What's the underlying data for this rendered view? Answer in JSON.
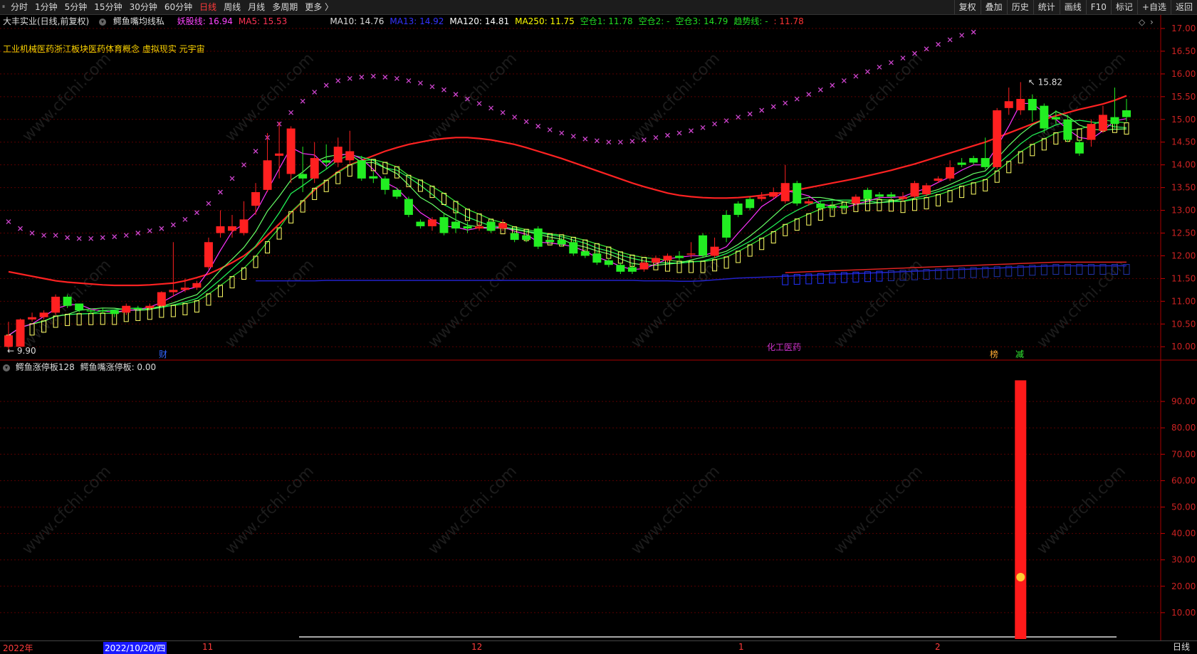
{
  "toolbar": {
    "left_items": [
      "分时",
      "1分钟",
      "5分钟",
      "15分钟",
      "30分钟",
      "60分钟",
      "日线",
      "周线",
      "月线",
      "多周期",
      "更多 〉"
    ],
    "active": "日线",
    "right_items": [
      "复权",
      "叠加",
      "历史",
      "统计",
      "画线",
      "F10",
      "标记",
      "+自选",
      "返回"
    ]
  },
  "header": {
    "stock": "大丰实业(日线,前复权)",
    "indicator": "鳄鱼嘴均线私",
    "values": [
      {
        "label": "妖股线: 16.94",
        "color": "#ff44ff"
      },
      {
        "label": "MA5: 15.53",
        "color": "#ff3355"
      },
      {
        "label": "MA10: 14.76",
        "color": "#dddddd"
      },
      {
        "label": "MA13: 14.92",
        "color": "#3333ff"
      },
      {
        "label": "MA120: 14.81",
        "color": "#ffffff"
      },
      {
        "label": "MA250: 11.75",
        "color": "#ffff00"
      },
      {
        "label": "空仓1: 11.78",
        "color": "#22dd22"
      },
      {
        "label": "空仓2: -",
        "color": "#22dd22"
      },
      {
        "label": "空仓3: 14.79",
        "color": "#22dd22"
      },
      {
        "label": "趋势线: -",
        "color": "#22dd22"
      },
      {
        "label": ": 11.78",
        "color": "#ff3333"
      }
    ]
  },
  "concepts": "工业机械医药浙江板块医药体育概念 虚拟现实 元宇宙",
  "annotations": {
    "low_label": "9.90",
    "high_label": "15.82",
    "marker_cai": "财",
    "marker_chem": "化工医药",
    "marker_bang": "榜",
    "marker_jian": "减"
  },
  "price_axis": [
    "17.00",
    "16.50",
    "16.00",
    "15.50",
    "15.00",
    "14.50",
    "14.00",
    "13.50",
    "13.00",
    "12.50",
    "12.00",
    "11.50",
    "11.00",
    "10.50",
    "10.00"
  ],
  "lower_panel": {
    "title": "鳄鱼涨停板128",
    "value": "鳄鱼嘴涨停板: 0.00",
    "axis": [
      "90.00",
      "80.00",
      "70.00",
      "60.00",
      "50.00",
      "40.00",
      "30.00",
      "20.00",
      "10.00"
    ],
    "bar_value": 98
  },
  "timeline": {
    "year": "2022年",
    "date_box": "2022/10/20/四",
    "months": [
      "11",
      "12",
      "1",
      "2"
    ]
  },
  "period_label": "日线",
  "watermark": "www.cfchi.com",
  "colors": {
    "up": "#ff2020",
    "down": "#22ee22",
    "ma_red": "#ff2222",
    "magenta": "#ff33ff",
    "cross": "#cc44cc",
    "blue": "#2222cc",
    "yellow": "#ffff66"
  },
  "chart_data": {
    "type": "candlestick",
    "price_range": [
      9.8,
      17.0
    ],
    "candles": [
      {
        "o": 10.0,
        "c": 10.25,
        "h": 10.55,
        "l": 9.9
      },
      {
        "o": 10.0,
        "c": 10.6,
        "h": 10.62,
        "l": 10.0
      },
      {
        "o": 10.6,
        "c": 10.65,
        "h": 10.75,
        "l": 10.55
      },
      {
        "o": 10.65,
        "c": 10.75,
        "h": 10.8,
        "l": 10.6
      },
      {
        "o": 10.75,
        "c": 11.1,
        "h": 11.15,
        "l": 10.7
      },
      {
        "o": 11.1,
        "c": 10.9,
        "h": 11.15,
        "l": 10.85
      },
      {
        "o": 10.95,
        "c": 10.8,
        "h": 10.95,
        "l": 10.75
      },
      {
        "o": 10.8,
        "c": 10.78,
        "h": 10.85,
        "l": 10.72
      },
      {
        "o": 10.8,
        "c": 10.78,
        "h": 10.85,
        "l": 10.72
      },
      {
        "o": 10.8,
        "c": 10.72,
        "h": 10.82,
        "l": 10.65
      },
      {
        "o": 10.75,
        "c": 10.9,
        "h": 10.95,
        "l": 10.7
      },
      {
        "o": 10.85,
        "c": 10.82,
        "h": 10.9,
        "l": 10.78
      },
      {
        "o": 10.85,
        "c": 10.9,
        "h": 10.95,
        "l": 10.8
      },
      {
        "o": 10.9,
        "c": 11.2,
        "h": 11.22,
        "l": 10.88
      },
      {
        "o": 11.2,
        "c": 11.25,
        "h": 12.3,
        "l": 11.1
      },
      {
        "o": 11.25,
        "c": 11.3,
        "h": 11.5,
        "l": 11.2
      },
      {
        "o": 11.3,
        "c": 11.4,
        "h": 11.45,
        "l": 11.25
      },
      {
        "o": 11.75,
        "c": 12.3,
        "h": 12.4,
        "l": 11.7
      },
      {
        "o": 12.5,
        "c": 12.65,
        "h": 13.0,
        "l": 12.4
      },
      {
        "o": 12.55,
        "c": 12.65,
        "h": 12.9,
        "l": 12.4
      },
      {
        "o": 12.5,
        "c": 12.8,
        "h": 13.2,
        "l": 12.45
      },
      {
        "o": 13.1,
        "c": 13.4,
        "h": 13.6,
        "l": 12.9
      },
      {
        "o": 13.45,
        "c": 14.1,
        "h": 14.7,
        "l": 13.4
      },
      {
        "o": 14.2,
        "c": 14.25,
        "h": 14.95,
        "l": 13.7
      },
      {
        "o": 13.8,
        "c": 14.8,
        "h": 14.85,
        "l": 13.6
      },
      {
        "o": 13.8,
        "c": 13.7,
        "h": 14.4,
        "l": 13.4
      },
      {
        "o": 13.7,
        "c": 14.15,
        "h": 14.5,
        "l": 13.6
      },
      {
        "o": 14.1,
        "c": 14.05,
        "h": 14.45,
        "l": 13.9
      },
      {
        "o": 14.05,
        "c": 14.4,
        "h": 14.6,
        "l": 13.95
      },
      {
        "o": 14.1,
        "c": 14.3,
        "h": 14.75,
        "l": 14.0
      },
      {
        "o": 14.1,
        "c": 13.7,
        "h": 14.2,
        "l": 13.65
      },
      {
        "o": 13.75,
        "c": 13.7,
        "h": 13.85,
        "l": 13.6
      },
      {
        "o": 13.7,
        "c": 13.45,
        "h": 13.75,
        "l": 13.35
      },
      {
        "o": 13.45,
        "c": 13.3,
        "h": 13.5,
        "l": 13.25
      },
      {
        "o": 13.25,
        "c": 12.9,
        "h": 13.3,
        "l": 12.85
      },
      {
        "o": 12.75,
        "c": 12.65,
        "h": 12.8,
        "l": 12.6
      },
      {
        "o": 12.65,
        "c": 12.8,
        "h": 12.85,
        "l": 12.55
      },
      {
        "o": 12.85,
        "c": 12.5,
        "h": 12.95,
        "l": 12.45
      },
      {
        "o": 12.75,
        "c": 12.6,
        "h": 13.05,
        "l": 12.5
      },
      {
        "o": 12.65,
        "c": 12.6,
        "h": 12.75,
        "l": 12.5
      },
      {
        "o": 12.6,
        "c": 12.65,
        "h": 12.75,
        "l": 12.55
      },
      {
        "o": 12.75,
        "c": 12.55,
        "h": 12.8,
        "l": 12.5
      },
      {
        "o": 12.6,
        "c": 12.72,
        "h": 12.8,
        "l": 12.55
      },
      {
        "o": 12.5,
        "c": 12.35,
        "h": 12.55,
        "l": 12.3
      },
      {
        "o": 12.45,
        "c": 12.35,
        "h": 12.55,
        "l": 12.3
      },
      {
        "o": 12.6,
        "c": 12.2,
        "h": 12.65,
        "l": 12.15
      },
      {
        "o": 12.35,
        "c": 12.3,
        "h": 12.4,
        "l": 12.25
      },
      {
        "o": 12.35,
        "c": 12.25,
        "h": 12.4,
        "l": 12.2
      },
      {
        "o": 12.3,
        "c": 12.05,
        "h": 12.35,
        "l": 12.0
      },
      {
        "o": 12.1,
        "c": 12.0,
        "h": 12.15,
        "l": 11.95
      },
      {
        "o": 12.05,
        "c": 11.85,
        "h": 12.1,
        "l": 11.8
      },
      {
        "o": 11.9,
        "c": 11.8,
        "h": 11.95,
        "l": 11.75
      },
      {
        "o": 11.8,
        "c": 11.65,
        "h": 11.85,
        "l": 11.6
      },
      {
        "o": 11.75,
        "c": 11.65,
        "h": 11.85,
        "l": 11.6
      },
      {
        "o": 11.7,
        "c": 11.85,
        "h": 11.9,
        "l": 11.65
      },
      {
        "o": 11.85,
        "c": 11.95,
        "h": 12.0,
        "l": 11.8
      },
      {
        "o": 11.9,
        "c": 12.0,
        "h": 12.05,
        "l": 11.85
      },
      {
        "o": 12.0,
        "c": 11.95,
        "h": 12.1,
        "l": 11.9
      },
      {
        "o": 12.05,
        "c": 12.05,
        "h": 12.3,
        "l": 11.95
      },
      {
        "o": 12.45,
        "c": 12.0,
        "h": 12.5,
        "l": 11.95
      },
      {
        "o": 12.0,
        "c": 12.2,
        "h": 12.4,
        "l": 11.95
      },
      {
        "o": 12.9,
        "c": 12.4,
        "h": 13.0,
        "l": 12.3
      },
      {
        "o": 13.15,
        "c": 12.9,
        "h": 13.2,
        "l": 12.85
      },
      {
        "o": 13.25,
        "c": 13.05,
        "h": 13.3,
        "l": 13.0
      },
      {
        "o": 13.25,
        "c": 13.3,
        "h": 13.4,
        "l": 13.2
      },
      {
        "o": 13.3,
        "c": 13.4,
        "h": 13.5,
        "l": 13.25
      },
      {
        "o": 13.2,
        "c": 13.6,
        "h": 14.0,
        "l": 13.15
      },
      {
        "o": 13.6,
        "c": 13.15,
        "h": 13.65,
        "l": 13.1
      },
      {
        "o": 13.15,
        "c": 13.2,
        "h": 13.25,
        "l": 13.1
      },
      {
        "o": 13.15,
        "c": 13.05,
        "h": 13.2,
        "l": 13.0
      },
      {
        "o": 13.1,
        "c": 13.05,
        "h": 13.2,
        "l": 13.0
      },
      {
        "o": 13.1,
        "c": 13.05,
        "h": 13.15,
        "l": 13.0
      },
      {
        "o": 13.15,
        "c": 13.3,
        "h": 13.35,
        "l": 13.1
      },
      {
        "o": 13.45,
        "c": 13.25,
        "h": 13.5,
        "l": 13.2
      },
      {
        "o": 13.35,
        "c": 13.3,
        "h": 13.4,
        "l": 13.25
      },
      {
        "o": 13.35,
        "c": 13.3,
        "h": 13.4,
        "l": 13.25
      },
      {
        "o": 13.25,
        "c": 13.3,
        "h": 13.4,
        "l": 13.2
      },
      {
        "o": 13.3,
        "c": 13.6,
        "h": 13.65,
        "l": 13.25
      },
      {
        "o": 13.35,
        "c": 13.55,
        "h": 13.6,
        "l": 13.3
      },
      {
        "o": 13.65,
        "c": 13.7,
        "h": 13.75,
        "l": 13.6
      },
      {
        "o": 13.7,
        "c": 13.95,
        "h": 14.1,
        "l": 13.65
      },
      {
        "o": 14.05,
        "c": 14.0,
        "h": 14.15,
        "l": 13.95
      },
      {
        "o": 14.15,
        "c": 14.05,
        "h": 14.2,
        "l": 14.0
      },
      {
        "o": 14.15,
        "c": 13.95,
        "h": 14.6,
        "l": 13.9
      },
      {
        "o": 13.95,
        "c": 15.2,
        "h": 15.25,
        "l": 13.9
      },
      {
        "o": 15.25,
        "c": 15.4,
        "h": 15.7,
        "l": 15.1
      },
      {
        "o": 15.2,
        "c": 15.45,
        "h": 15.82,
        "l": 15.1
      },
      {
        "o": 15.45,
        "c": 15.2,
        "h": 15.55,
        "l": 14.95
      },
      {
        "o": 15.3,
        "c": 14.8,
        "h": 15.35,
        "l": 14.7
      },
      {
        "o": 15.05,
        "c": 15.0,
        "h": 15.2,
        "l": 14.9
      },
      {
        "o": 15.0,
        "c": 14.55,
        "h": 15.1,
        "l": 14.5
      },
      {
        "o": 14.5,
        "c": 14.25,
        "h": 14.55,
        "l": 14.2
      },
      {
        "o": 14.55,
        "c": 14.9,
        "h": 15.0,
        "l": 14.4
      },
      {
        "o": 14.75,
        "c": 15.1,
        "h": 15.3,
        "l": 14.7
      },
      {
        "o": 15.05,
        "c": 14.9,
        "h": 15.7,
        "l": 14.8
      },
      {
        "o": 15.2,
        "c": 15.05,
        "h": 15.45,
        "l": 14.95
      }
    ],
    "ma120": [
      11.65,
      11.6,
      11.55,
      11.5,
      11.45,
      11.42,
      11.4,
      11.38,
      11.36,
      11.35,
      11.35,
      11.35,
      11.36,
      11.38,
      11.4,
      11.45,
      11.52,
      11.6,
      11.72,
      11.85,
      12.0,
      12.2,
      12.45,
      12.7,
      12.95,
      13.2,
      13.45,
      13.65,
      13.85,
      14.0,
      14.1,
      14.2,
      14.3,
      14.38,
      14.45,
      14.5,
      14.55,
      14.58,
      14.6,
      14.6,
      14.58,
      14.55,
      14.5,
      14.45,
      14.38,
      14.3,
      14.22,
      14.14,
      14.05,
      13.96,
      13.87,
      13.78,
      13.69,
      13.6,
      13.52,
      13.45,
      13.38,
      13.33,
      13.3,
      13.28,
      13.27,
      13.27,
      13.28,
      13.3,
      13.33,
      13.36,
      13.4,
      13.45,
      13.5,
      13.55,
      13.6,
      13.65,
      13.7,
      13.76,
      13.82,
      13.88,
      13.95,
      14.02,
      14.1,
      14.18,
      14.26,
      14.34,
      14.42,
      14.5,
      14.6,
      14.7,
      14.8,
      14.9,
      15.0,
      15.08,
      15.15,
      15.22,
      15.28,
      15.34,
      15.42,
      15.52
    ],
    "ma250": [
      null,
      null,
      null,
      null,
      null,
      null,
      null,
      null,
      null,
      null,
      null,
      null,
      null,
      null,
      null,
      null,
      null,
      null,
      null,
      null,
      null,
      11.45,
      11.45,
      11.45,
      11.45,
      11.45,
      11.45,
      11.46,
      11.46,
      11.46,
      11.46,
      11.46,
      11.46,
      11.46,
      11.46,
      11.46,
      11.46,
      11.46,
      11.46,
      11.46,
      11.46,
      11.46,
      11.46,
      11.46,
      11.46,
      11.46,
      11.46,
      11.46,
      11.46,
      11.46,
      11.46,
      11.46,
      11.46,
      11.46,
      11.45,
      11.45,
      11.45,
      11.44,
      11.44,
      11.45,
      11.47,
      11.49,
      11.51,
      11.52,
      11.53,
      11.54,
      11.55,
      11.56,
      11.57,
      11.58,
      11.59,
      11.6,
      11.61,
      11.62,
      11.63,
      11.64,
      11.65,
      11.66,
      11.67,
      11.68,
      11.69,
      11.7,
      11.71,
      11.72,
      11.73,
      11.74,
      11.75,
      11.76,
      11.77,
      11.78,
      11.78,
      11.78,
      11.78,
      11.78,
      11.78,
      11.78
    ],
    "cross_line": [
      12.75,
      12.6,
      12.5,
      12.45,
      12.45,
      12.4,
      12.38,
      12.38,
      12.4,
      12.42,
      12.45,
      12.5,
      12.55,
      12.6,
      12.68,
      12.8,
      12.95,
      13.15,
      13.4,
      13.7,
      14.0,
      14.3,
      14.6,
      14.9,
      15.15,
      15.4,
      15.6,
      15.75,
      15.85,
      15.9,
      15.93,
      15.95,
      15.93,
      15.9,
      15.85,
      15.8,
      15.72,
      15.65,
      15.55,
      15.45,
      15.35,
      15.25,
      15.15,
      15.05,
      14.95,
      14.85,
      14.77,
      14.7,
      14.63,
      14.57,
      14.53,
      14.5,
      14.5,
      14.52,
      14.55,
      14.6,
      14.65,
      14.7,
      14.75,
      14.82,
      14.9,
      14.97,
      15.05,
      15.12,
      15.2,
      15.28,
      15.36,
      15.45,
      15.55,
      15.65,
      15.75,
      15.85,
      15.95,
      16.05,
      16.15,
      16.25,
      16.35,
      16.45,
      16.55,
      16.65,
      16.75,
      16.85,
      16.92
    ],
    "lower_bars": [
      {
        "index": 86,
        "value": 98
      }
    ]
  }
}
